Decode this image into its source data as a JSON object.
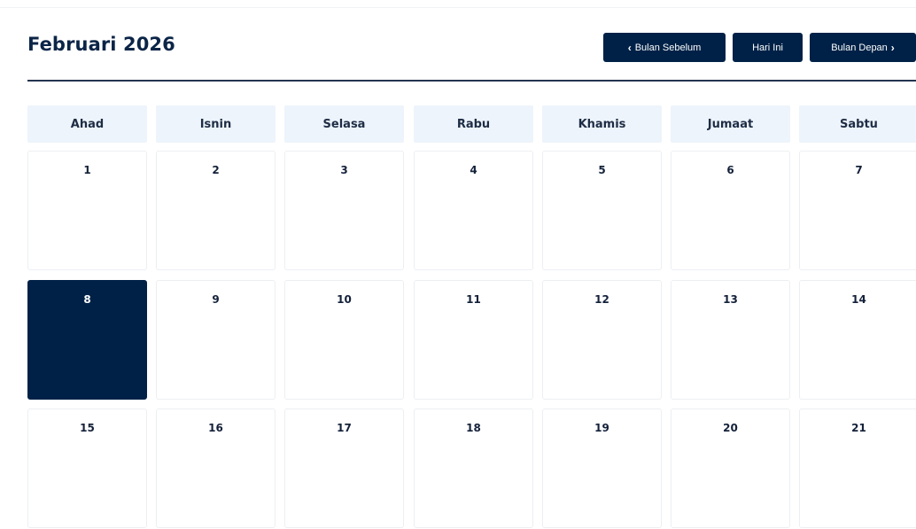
{
  "calendar": {
    "month_title": "Februari 2026",
    "buttons": {
      "prev_label": "Bulan Sebelum",
      "today_label": "Hari Ini",
      "next_label": "Bulan Depan"
    },
    "weekdays": [
      "Ahad",
      "Isnin",
      "Selasa",
      "Rabu",
      "Khamis",
      "Jumaat",
      "Sabtu"
    ],
    "weeks": [
      [
        "1",
        "2",
        "3",
        "4",
        "5",
        "6",
        "7"
      ],
      [
        "8",
        "9",
        "10",
        "11",
        "12",
        "13",
        "14"
      ],
      [
        "15",
        "16",
        "17",
        "18",
        "19",
        "20",
        "21"
      ]
    ],
    "selected_day": "8",
    "colors": {
      "primary": "#002147",
      "header_bg": "#edf4fb",
      "title": "#0b2547"
    }
  },
  "icons": {
    "prev": "chevron-left-icon",
    "next": "chevron-right-icon"
  }
}
